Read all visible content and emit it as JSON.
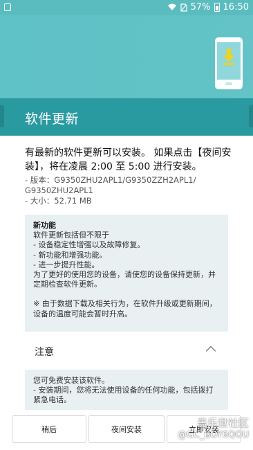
{
  "status_bar": {
    "battery": "57%",
    "time": "16:50"
  },
  "header": {
    "title": "软件更新"
  },
  "update": {
    "message": "有最新的软件更新可以安装。 如果点击【夜间安装】，将在凌晨 2:00 至 5:00 进行安装。",
    "version_line1": "- 版本：G9350ZHU2APL1/G9350ZZH2APL1/",
    "version_line2": "G9350ZHU2APL1",
    "size": "- 大小：52.71 MB"
  },
  "features": {
    "heading": "新功能",
    "lines": [
      "软件更新包括但不限于",
      "- 设备稳定性增强以及故障修复。",
      "- 新功能和增强功能。",
      "- 进一步提升性能。",
      "为了更好的使用您的设备，请使您的设备保持更新，并定期检查软件更新。"
    ],
    "note": "※ 由于数据下载及相关行为，在软件升级或更新期间，设备的温度可能会暂时升高。"
  },
  "notice": {
    "title": "注意",
    "lines": [
      "您可免费安装该软件。",
      "- 安装期间，您将无法使用设备的任何功能，包括拨打紧急电话。"
    ]
  },
  "buttons": {
    "later": "稍后",
    "night_install": "夜间安装",
    "install_now": "立即安装"
  },
  "watermark": {
    "line1": "盖乐世社区",
    "line2": "@GC_BOY6QOU"
  },
  "colors": {
    "accent": "#2a9aa1",
    "hero": "#5fc2c6",
    "download_arrow": "#f2d21a"
  }
}
